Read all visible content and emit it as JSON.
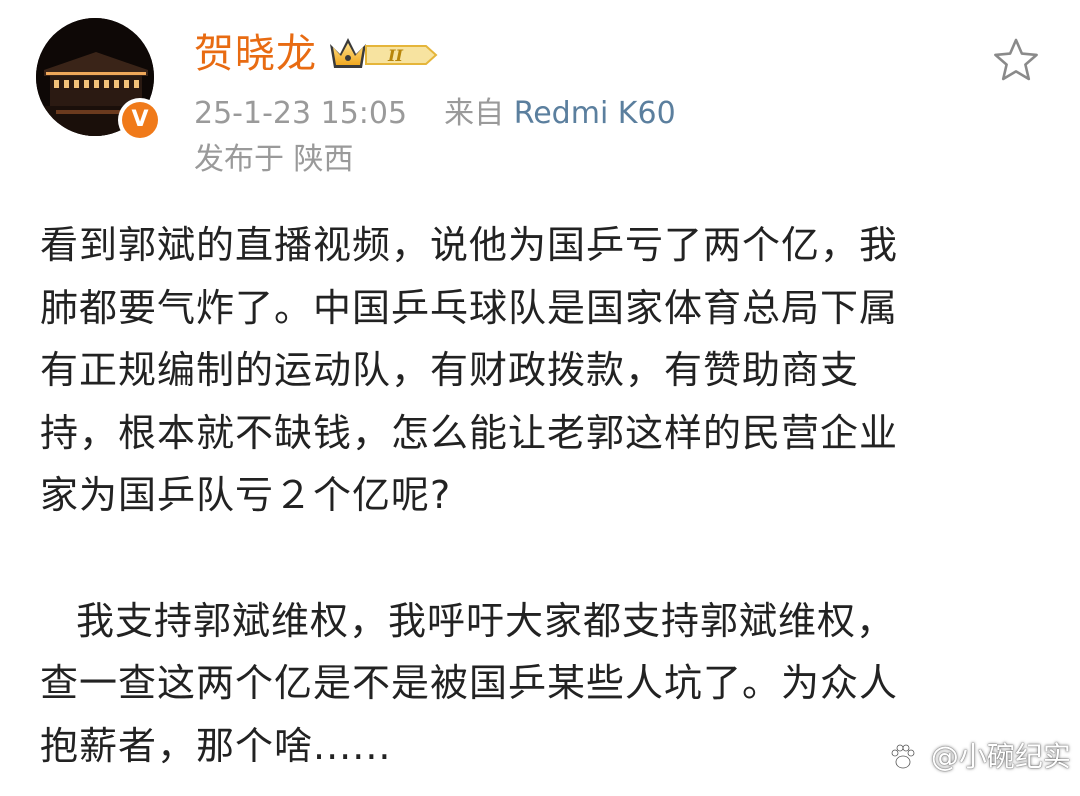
{
  "post": {
    "author": {
      "name": "贺晓龙",
      "vip_level": "II"
    },
    "meta": {
      "timestamp": "25-1-23 15:05",
      "source_prefix": "来自",
      "source_device": "Redmi K60",
      "location": "发布于 陕西"
    },
    "body_lines": [
      "看到郭斌的直播视频，说他为国乒亏了两个亿，我",
      "肺都要气炸了。中国乒乓球队是国家体育总局下属",
      "有正规编制的运动队，有财政拨款，有赞助商支",
      "持，根本就不缺钱，怎么能让老郭这样的民营企业",
      "家为国乒队亏２个亿呢?"
    ],
    "body_lines_2": [
      "我支持郭斌维权，我呼吁大家都支持郭斌维权，",
      "查一查这两个亿是不是被国乒某些人坑了。为众人",
      "抱薪者，那个啥......"
    ]
  },
  "watermark": {
    "text": "@小碗纪实"
  },
  "colors": {
    "username": "#e86b12",
    "meta_gray": "#9a9a9a",
    "device_blue": "#5b7f9e",
    "body_text": "#222222",
    "verified_orange": "#f07a1a",
    "vip_gold": "#f2b632"
  },
  "icons": {
    "star": "star-outline-icon",
    "verified": "verified-v-icon",
    "vip": "crown-vip-badge-icon"
  }
}
